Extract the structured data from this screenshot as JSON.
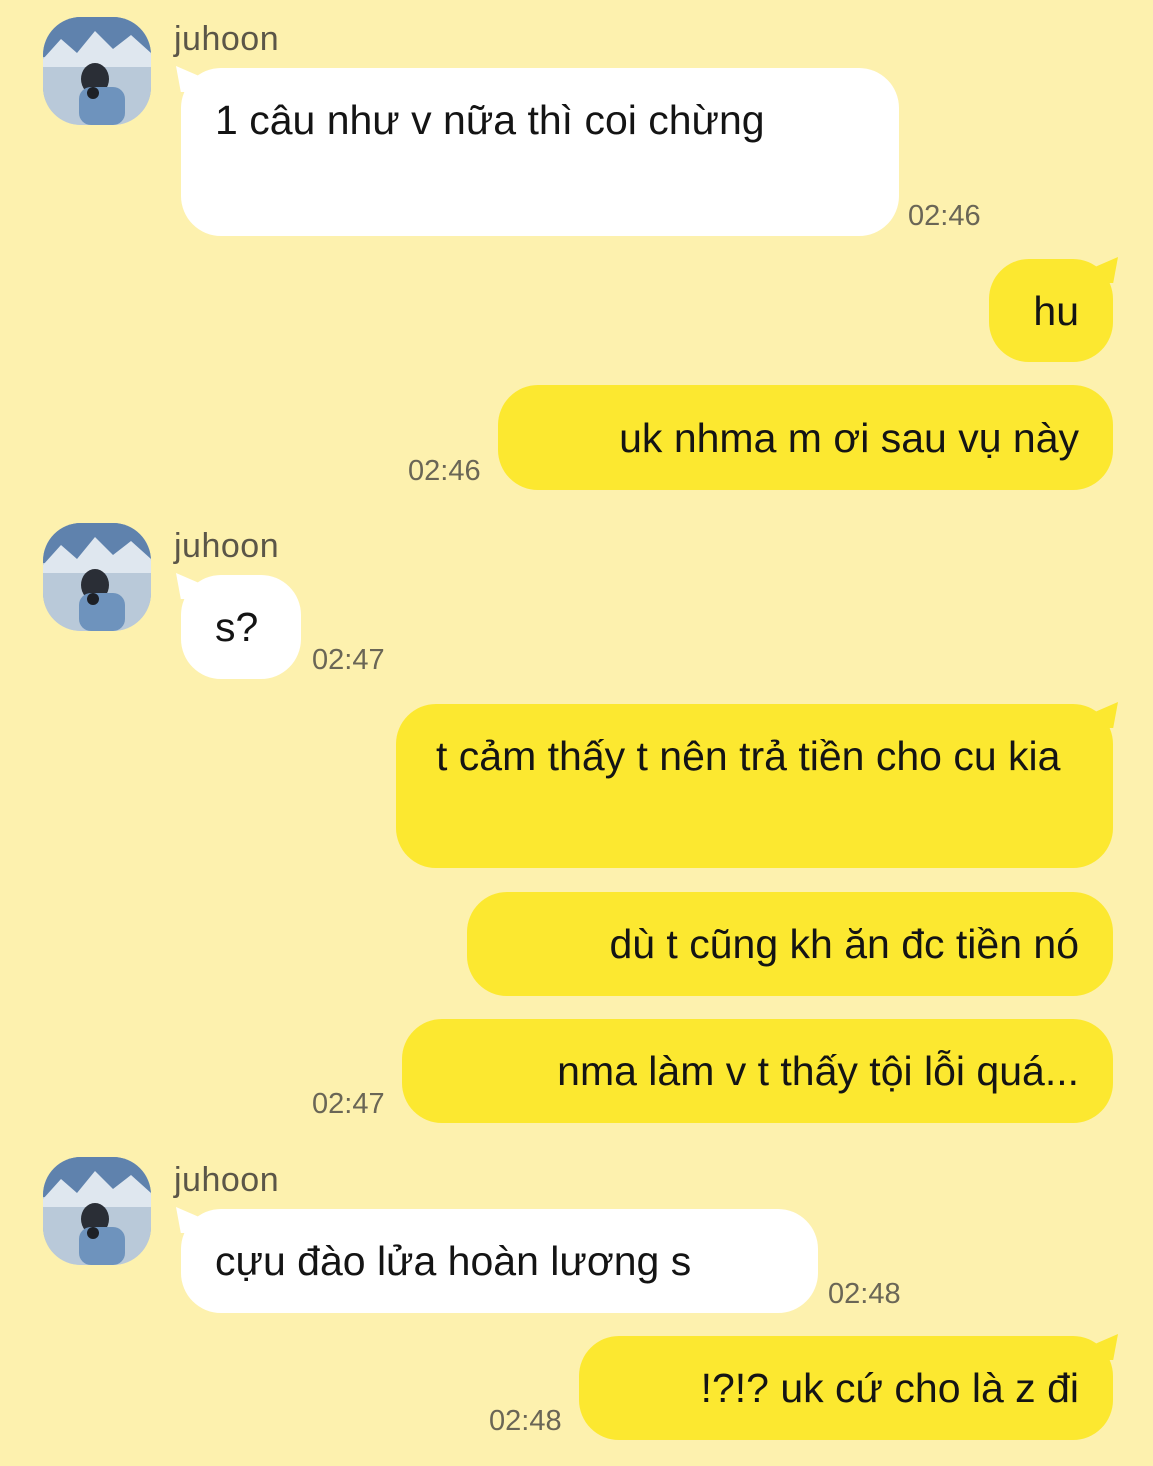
{
  "contact": {
    "name": "juhoon"
  },
  "messages": [
    {
      "from": "contact",
      "text": "1 câu như v nữa thì coi chừng",
      "time": "02:46"
    },
    {
      "from": "me",
      "text": "hu",
      "time": ""
    },
    {
      "from": "me",
      "text": "uk nhma m ơi sau vụ này",
      "time": "02:46"
    },
    {
      "from": "contact",
      "text": "s?",
      "time": "02:47"
    },
    {
      "from": "me",
      "text": "t cảm thấy t nên trả tiền cho cu kia",
      "time": ""
    },
    {
      "from": "me",
      "text": "dù t cũng kh ăn đc tiền nó",
      "time": ""
    },
    {
      "from": "me",
      "text": "nma làm v t thấy tội lỗi quá...",
      "time": "02:47"
    },
    {
      "from": "contact",
      "text": "cựu đào lửa hoàn lương s",
      "time": "02:48"
    },
    {
      "from": "me",
      "text": "!?!? uk cứ cho là z đi",
      "time": "02:48"
    }
  ],
  "colors": {
    "background": "#FDF1AE",
    "incoming_bubble": "#FFFFFF",
    "outgoing_bubble": "#FCE830"
  },
  "icons": {
    "avatar": "profile-photo-mountain-landscape"
  }
}
